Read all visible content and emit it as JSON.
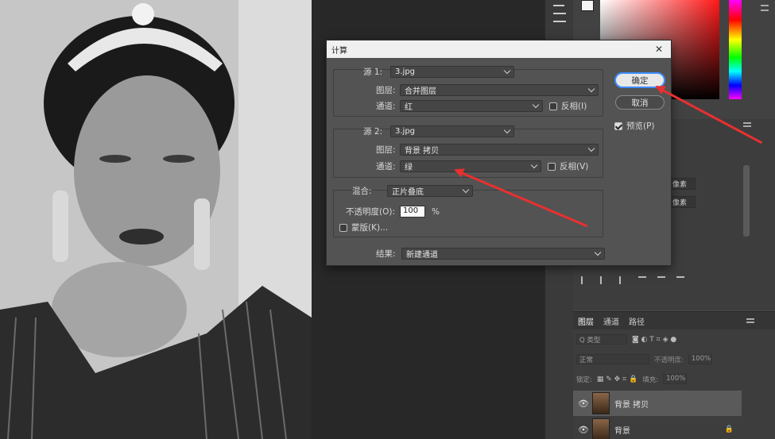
{
  "dialog": {
    "title": "计算",
    "close_icon": "close-icon",
    "source1": {
      "label": "源 1:",
      "value": "3.jpg"
    },
    "source1_layer": {
      "label": "图层:",
      "value": "合并图层"
    },
    "source1_channel": {
      "label": "通道:",
      "value": "红",
      "invert_label": "反相(I)",
      "invert_checked": false
    },
    "source2": {
      "label": "源 2:",
      "value": "3.jpg"
    },
    "source2_layer": {
      "label": "图层:",
      "value": "背景 拷贝"
    },
    "source2_channel": {
      "label": "通道:",
      "value": "绿",
      "invert_label": "反相(V)",
      "invert_checked": false
    },
    "blending": {
      "label": "混合:",
      "value": "正片叠底"
    },
    "opacity": {
      "label": "不透明度(O):",
      "value": "100",
      "unit": "%"
    },
    "mask": {
      "label": "蒙版(K)...",
      "checked": false
    },
    "result": {
      "label": "结果:",
      "value": "新建通道"
    },
    "ok_label": "确定",
    "cancel_label": "取消",
    "preview": {
      "label": "预览(P)",
      "checked": true
    }
  },
  "panels": {
    "layers_tabs": [
      "图层",
      "通道",
      "路径"
    ],
    "search_placeholder": "Q 类型",
    "blend_mode": "正常",
    "opacity_label": "不透明度:",
    "opacity_value": "100%",
    "lock_label": "锁定:",
    "fill_label": "填充:",
    "fill_value": "100%",
    "layers": [
      {
        "name": "背景 拷贝",
        "visible": true,
        "selected": true
      },
      {
        "name": "背景",
        "visible": true,
        "selected": false,
        "locked": true
      }
    ],
    "properties_fields": [
      "像素",
      "像素"
    ]
  },
  "colors": {
    "accent": "#3f8cff",
    "arrow": "#e83030",
    "dialog_bg": "#535353"
  }
}
